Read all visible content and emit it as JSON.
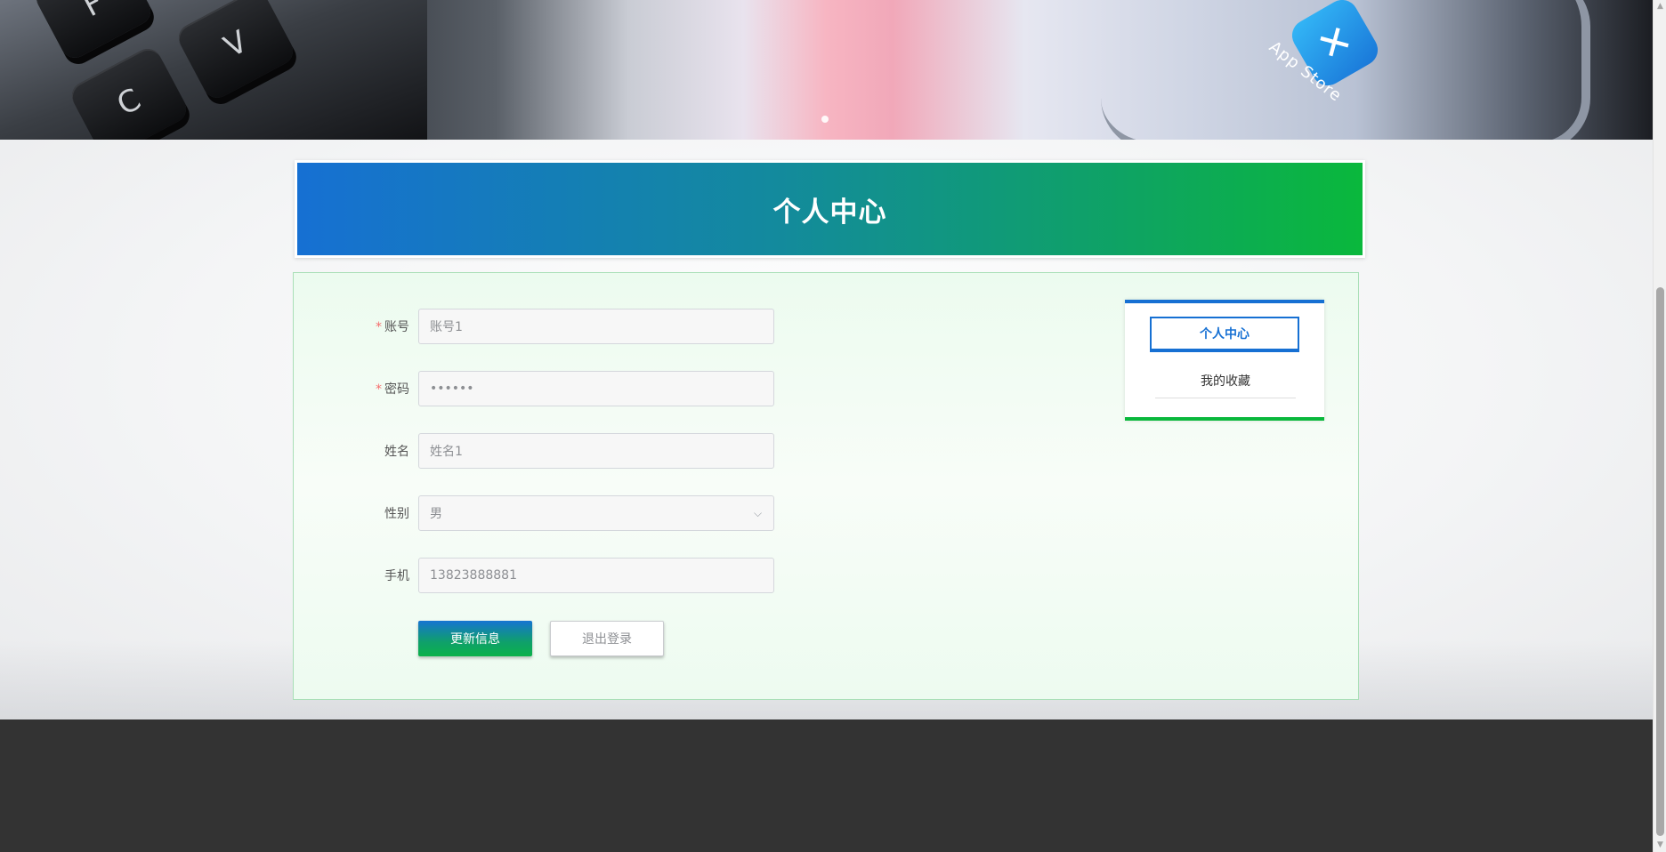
{
  "hero": {
    "keys": [
      "F",
      "V",
      "C"
    ],
    "app_icon": "app-store-icon",
    "app_label": "App Store"
  },
  "page_title": "个人中心",
  "form": {
    "account": {
      "label": "账号",
      "required": true,
      "value": "账号1"
    },
    "password": {
      "label": "密码",
      "required": true,
      "value": "••••••"
    },
    "name": {
      "label": "姓名",
      "required": false,
      "value": "姓名1"
    },
    "gender": {
      "label": "性别",
      "required": false,
      "value": "男"
    },
    "phone": {
      "label": "手机",
      "required": false,
      "value": "13823888881"
    }
  },
  "buttons": {
    "update": "更新信息",
    "logout": "退出登录"
  },
  "side_menu": {
    "items": [
      {
        "label": "个人中心",
        "active": true
      },
      {
        "label": "我的收藏",
        "active": false
      }
    ]
  },
  "colors": {
    "primary_blue": "#1670d3",
    "primary_green": "#0ab83c",
    "required_star": "#f56c6c",
    "footer": "#333333"
  }
}
